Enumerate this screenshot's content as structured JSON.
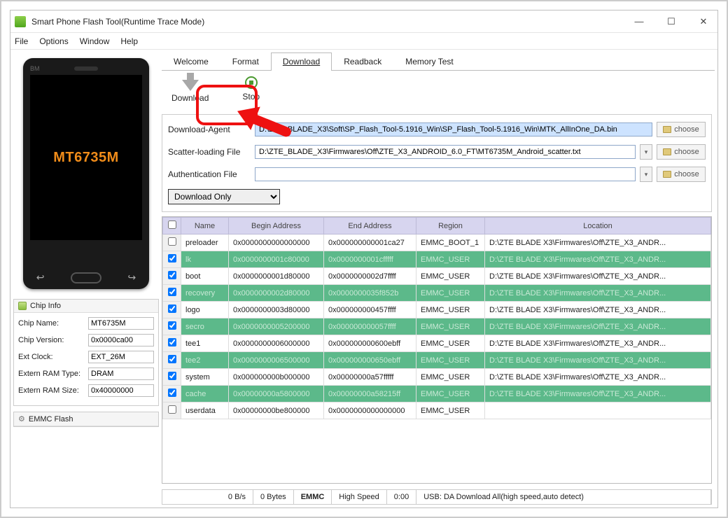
{
  "window": {
    "title": "Smart Phone Flash Tool(Runtime Trace Mode)"
  },
  "menu": {
    "file": "File",
    "options": "Options",
    "window": "Window",
    "help": "Help"
  },
  "phone": {
    "brand": "BM",
    "chip": "MT6735M"
  },
  "chipinfo": {
    "header": "Chip Info",
    "rows": [
      {
        "label": "Chip Name:",
        "value": "MT6735M"
      },
      {
        "label": "Chip Version:",
        "value": "0x0000ca00"
      },
      {
        "label": "Ext Clock:",
        "value": "EXT_26M"
      },
      {
        "label": "Extern RAM Type:",
        "value": "DRAM"
      },
      {
        "label": "Extern RAM Size:",
        "value": "0x40000000"
      }
    ]
  },
  "emmc": {
    "header": "EMMC Flash"
  },
  "tabs": {
    "welcome": "Welcome",
    "format": "Format",
    "download": "Download",
    "readback": "Readback",
    "memtest": "Memory Test"
  },
  "toolbar": {
    "download": "Download",
    "stop": "Stop"
  },
  "files": {
    "da_label": "Download-Agent",
    "da_value": "D:\\ZTE_BLADE_X3\\Soft\\SP_Flash_Tool-5.1916_Win\\SP_Flash_Tool-5.1916_Win\\MTK_AllInOne_DA.bin",
    "scatter_label": "Scatter-loading File",
    "scatter_value": "D:\\ZTE_BLADE_X3\\Firmwares\\Off\\ZTE_X3_ANDROID_6.0_FT\\MT6735M_Android_scatter.txt",
    "auth_label": "Authentication File",
    "auth_value": "",
    "choose": "choose",
    "mode": "Download Only"
  },
  "table": {
    "headers": {
      "name": "Name",
      "begin": "Begin Address",
      "end": "End Address",
      "region": "Region",
      "location": "Location"
    },
    "rows": [
      {
        "c": false,
        "g": false,
        "name": "preloader",
        "begin": "0x0000000000000000",
        "end": "0x000000000001ca27",
        "region": "EMMC_BOOT_1",
        "loc": "D:\\ZTE BLADE X3\\Firmwares\\Off\\ZTE_X3_ANDR..."
      },
      {
        "c": true,
        "g": true,
        "name": "lk",
        "begin": "0x0000000001c80000",
        "end": "0x0000000001cfffff",
        "region": "EMMC_USER",
        "loc": "D:\\ZTE BLADE X3\\Firmwares\\Off\\ZTE_X3_ANDR..."
      },
      {
        "c": true,
        "g": false,
        "name": "boot",
        "begin": "0x0000000001d80000",
        "end": "0x0000000002d7ffff",
        "region": "EMMC_USER",
        "loc": "D:\\ZTE BLADE X3\\Firmwares\\Off\\ZTE_X3_ANDR..."
      },
      {
        "c": true,
        "g": true,
        "name": "recovery",
        "begin": "0x0000000002d80000",
        "end": "0x0000000035f852b",
        "region": "EMMC_USER",
        "loc": "D:\\ZTE BLADE X3\\Firmwares\\Off\\ZTE_X3_ANDR..."
      },
      {
        "c": true,
        "g": false,
        "name": "logo",
        "begin": "0x0000000003d80000",
        "end": "0x000000000457ffff",
        "region": "EMMC_USER",
        "loc": "D:\\ZTE BLADE X3\\Firmwares\\Off\\ZTE_X3_ANDR..."
      },
      {
        "c": true,
        "g": true,
        "name": "secro",
        "begin": "0x0000000005200000",
        "end": "0x000000000057ffff",
        "region": "EMMC_USER",
        "loc": "D:\\ZTE BLADE X3\\Firmwares\\Off\\ZTE_X3_ANDR..."
      },
      {
        "c": true,
        "g": false,
        "name": "tee1",
        "begin": "0x0000000006000000",
        "end": "0x000000000600ebff",
        "region": "EMMC_USER",
        "loc": "D:\\ZTE BLADE X3\\Firmwares\\Off\\ZTE_X3_ANDR..."
      },
      {
        "c": true,
        "g": true,
        "name": "tee2",
        "begin": "0x0000000006500000",
        "end": "0x000000000650ebff",
        "region": "EMMC_USER",
        "loc": "D:\\ZTE BLADE X3\\Firmwares\\Off\\ZTE_X3_ANDR..."
      },
      {
        "c": true,
        "g": false,
        "name": "system",
        "begin": "0x000000000b000000",
        "end": "0x00000000a57fffff",
        "region": "EMMC_USER",
        "loc": "D:\\ZTE BLADE X3\\Firmwares\\Off\\ZTE_X3_ANDR..."
      },
      {
        "c": true,
        "g": true,
        "name": "cache",
        "begin": "0x00000000a5800000",
        "end": "0x00000000a58215ff",
        "region": "EMMC_USER",
        "loc": "D:\\ZTE BLADE X3\\Firmwares\\Off\\ZTE_X3_ANDR..."
      },
      {
        "c": false,
        "g": false,
        "name": "userdata",
        "begin": "0x00000000be800000",
        "end": "0x0000000000000000",
        "region": "EMMC_USER",
        "loc": ""
      }
    ]
  },
  "status": {
    "rate": "0 B/s",
    "bytes": "0 Bytes",
    "storage": "EMMC",
    "speed": "High Speed",
    "time": "0:00",
    "usb": "USB: DA Download All(high speed,auto detect)"
  }
}
